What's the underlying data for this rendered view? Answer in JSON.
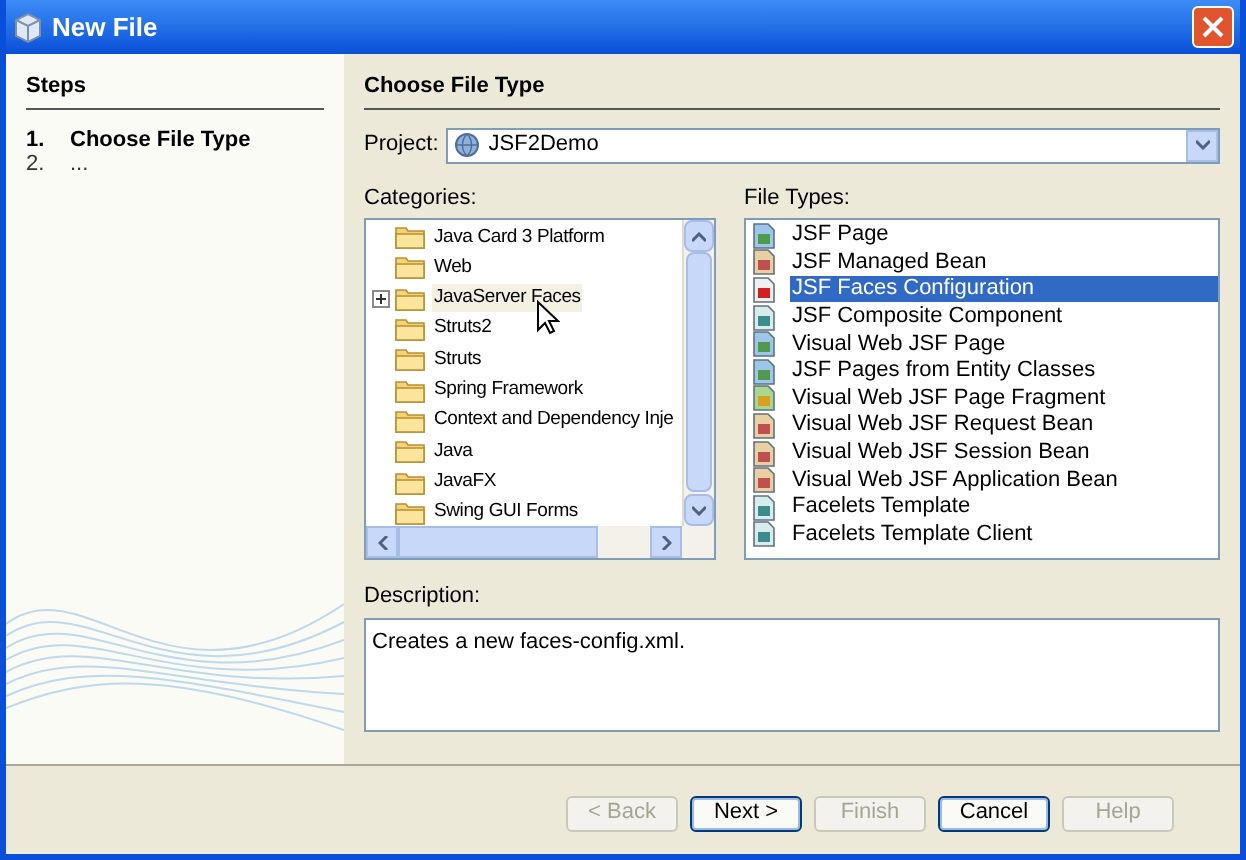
{
  "window": {
    "title": "New File"
  },
  "steps": {
    "title": "Steps",
    "items": [
      {
        "number": "1.",
        "label": "Choose File Type",
        "selected": true
      },
      {
        "number": "2.",
        "label": "...",
        "selected": false
      }
    ]
  },
  "panel": {
    "title": "Choose File Type"
  },
  "project": {
    "label": "Project:",
    "value": "JSF2Demo"
  },
  "categories": {
    "label": "Categories:",
    "items": [
      {
        "label": "Java Card 3 Platform",
        "has_children": false,
        "hovered": false
      },
      {
        "label": "Web",
        "has_children": false,
        "hovered": false
      },
      {
        "label": "JavaServer Faces",
        "has_children": true,
        "hovered": true
      },
      {
        "label": "Struts2",
        "has_children": false,
        "hovered": false
      },
      {
        "label": "Struts",
        "has_children": false,
        "hovered": false
      },
      {
        "label": "Spring Framework",
        "has_children": false,
        "hovered": false
      },
      {
        "label": "Context and Dependency Inje",
        "has_children": false,
        "hovered": false
      },
      {
        "label": "Java",
        "has_children": false,
        "hovered": false
      },
      {
        "label": "JavaFX",
        "has_children": false,
        "hovered": false
      },
      {
        "label": "Swing GUI Forms",
        "has_children": false,
        "hovered": false
      }
    ]
  },
  "file_types": {
    "label": "File Types:",
    "items": [
      {
        "label": "JSF Page",
        "kind": "page",
        "selected": false
      },
      {
        "label": "JSF Managed Bean",
        "kind": "bean",
        "selected": false
      },
      {
        "label": "JSF Faces Configuration",
        "kind": "config",
        "selected": true
      },
      {
        "label": "JSF Composite Component",
        "kind": "component",
        "selected": false
      },
      {
        "label": "Visual Web JSF Page",
        "kind": "page",
        "selected": false
      },
      {
        "label": "JSF Pages from Entity Classes",
        "kind": "page",
        "selected": false
      },
      {
        "label": "Visual Web JSF Page Fragment",
        "kind": "fragment",
        "selected": false
      },
      {
        "label": "Visual Web JSF Request Bean",
        "kind": "bean",
        "selected": false
      },
      {
        "label": "Visual Web JSF Session Bean",
        "kind": "bean",
        "selected": false
      },
      {
        "label": "Visual Web JSF Application Bean",
        "kind": "bean",
        "selected": false
      },
      {
        "label": "Facelets Template",
        "kind": "component",
        "selected": false
      },
      {
        "label": "Facelets Template Client",
        "kind": "component",
        "selected": false
      }
    ]
  },
  "description": {
    "label": "Description:",
    "value": "Creates a new faces-config.xml."
  },
  "buttons": [
    {
      "label": "< Back",
      "disabled": true,
      "default": false
    },
    {
      "label": "Next >",
      "disabled": false,
      "default": true
    },
    {
      "label": "Finish",
      "disabled": true,
      "default": false
    },
    {
      "label": "Cancel",
      "disabled": false,
      "default": true
    },
    {
      "label": "Help",
      "disabled": true,
      "default": false
    }
  ]
}
